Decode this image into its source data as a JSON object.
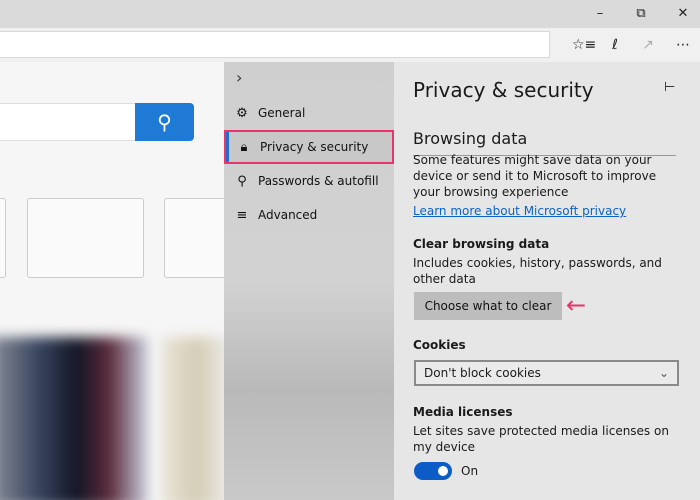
{
  "window": {
    "minimize_icon": "minimize-icon",
    "restore_icon": "restore-icon",
    "close_icon": "close-icon"
  },
  "toolbar": {
    "icons": [
      "favorites-icon",
      "pen-icon",
      "share-icon",
      "more-icon"
    ]
  },
  "sidebar": {
    "items": [
      {
        "label": "General",
        "icon": "gear-icon"
      },
      {
        "label": "Privacy & security",
        "icon": "lock-icon"
      },
      {
        "label": "Passwords & autofill",
        "icon": "key-icon"
      },
      {
        "label": "Advanced",
        "icon": "sliders-icon"
      }
    ]
  },
  "panel": {
    "title": "Privacy & security",
    "browsing": {
      "heading": "Browsing data",
      "desc": "Some features might save data on your device or send it to Microsoft to improve your browsing experience",
      "link": "Learn more about Microsoft privacy"
    },
    "clear": {
      "heading": "Clear browsing data",
      "desc": "Includes cookies, history, passwords, and other data",
      "button": "Choose what to clear"
    },
    "cookies": {
      "heading": "Cookies",
      "value": "Don't block cookies"
    },
    "media": {
      "heading": "Media licenses",
      "desc": "Let sites save protected media licenses on my device",
      "toggle_state": "On",
      "toggle_on": true
    }
  },
  "colors": {
    "accent": "#1f7ad6",
    "highlight": "#e8336b",
    "toggle": "#0b5cc7"
  }
}
